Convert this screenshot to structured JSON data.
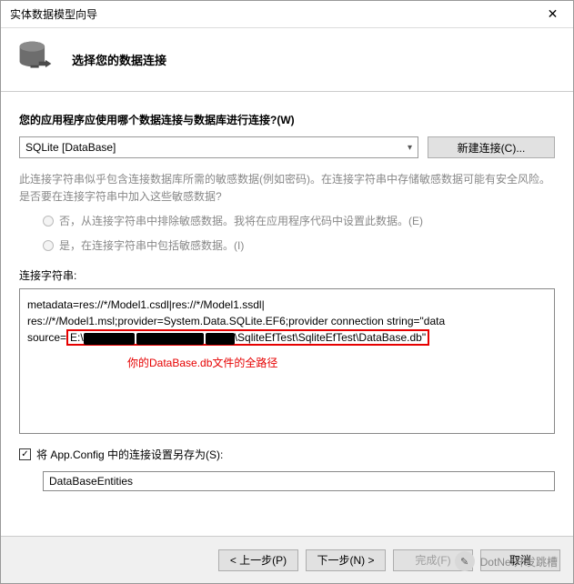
{
  "titlebar": {
    "title": "实体数据模型向导"
  },
  "header": {
    "subtitle": "选择您的数据连接"
  },
  "main": {
    "prompt": "您的应用程序应使用哪个数据连接与数据库进行连接?(W)",
    "selected_connection": "SQLite [DataBase]",
    "new_connection_btn": "新建连接(C)...",
    "info_text": "此连接字符串似乎包含连接数据库所需的敏感数据(例如密码)。在连接字符串中存储敏感数据可能有安全风险。是否要在连接字符串中加入这些敏感数据?",
    "radio_no": "否，从连接字符串中排除敏感数据。我将在应用程序代码中设置此数据。(E)",
    "radio_yes": "是，在连接字符串中包括敏感数据。(I)",
    "conn_string_label": "连接字符串:",
    "conn_string": {
      "line1": "metadata=res://*/Model1.csdl|res://*/Model1.ssdl|",
      "line2_pre": "res://*/Model1.msl;provider=System.Data.SQLite.EF6;provider connection string=\"data",
      "line3_source": "source=",
      "line3_drive": "E:\\",
      "line3_tail": "\\SqliteEfTest\\SqliteEfTest\\DataBase.db\""
    },
    "annotation": "你的DataBase.db文件的全路径",
    "save_checkbox_label": "将 App.Config 中的连接设置另存为(S):",
    "entity_name": "DataBaseEntities"
  },
  "footer": {
    "prev": "< 上一步(P)",
    "next": "下一步(N) >",
    "finish": "完成(F)",
    "cancel": "取消"
  },
  "watermark": {
    "text": "DotNet开发跳槽"
  }
}
